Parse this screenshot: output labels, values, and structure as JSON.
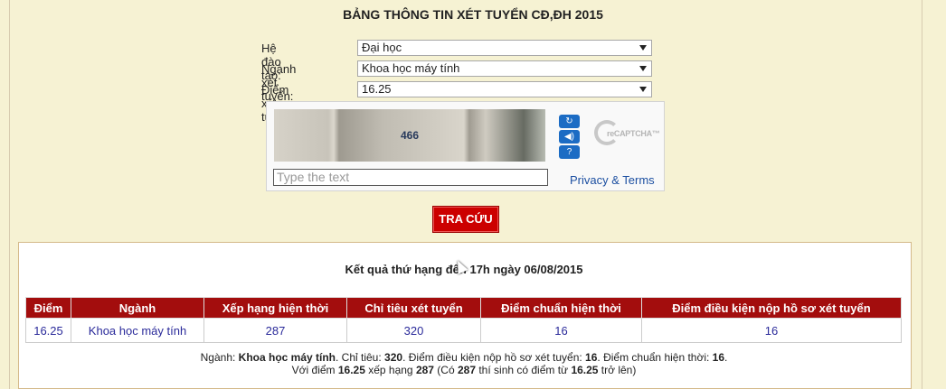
{
  "title": "BẢNG THÔNG TIN XÉT TUYỂN CĐ,ĐH 2015",
  "form": {
    "he_dao_tao_label": "Hệ đào tạo:",
    "he_dao_tao_value": "Đại học",
    "nganh_label": "Ngành xét tuyển:",
    "nganh_value": "Khoa học máy tính",
    "diem_label": "Điểm xét tuyển:",
    "diem_value": "16.25"
  },
  "captcha": {
    "image_text": "466",
    "input_placeholder": "Type the text",
    "logo_text": "reCAPTCHA™",
    "privacy_terms": "Privacy & Terms"
  },
  "search_button": "TRA CỨU",
  "result": {
    "title": "Kết quả thứ hạng đến 17h ngày 06/08/2015",
    "headers": [
      "Điểm",
      "Ngành",
      "Xếp hạng hiện thời",
      "Chỉ tiêu xét tuyển",
      "Điểm chuẩn hiện thời",
      "Điểm điều kiện nộp hồ sơ xét tuyển"
    ],
    "row": [
      "16.25",
      "Khoa học máy tính",
      "287",
      "320",
      "16",
      "16"
    ],
    "summary": {
      "l1_a": "Ngành: ",
      "l1_b": "Khoa học máy tính",
      "l1_c": ". Chỉ tiêu: ",
      "l1_d": "320",
      "l1_e": ". Điểm điều kiện nộp hồ sơ xét tuyển: ",
      "l1_f": "16",
      "l1_g": ". Điểm chuẩn hiện thời: ",
      "l1_h": "16",
      "l1_i": ".",
      "l2_a": "Với điểm ",
      "l2_b": "16.25",
      "l2_c": " xếp hạng ",
      "l2_d": "287",
      "l2_e": " (Có ",
      "l2_f": "287",
      "l2_g": " thí sinh có điểm từ ",
      "l2_h": "16.25",
      "l2_i": " trở lên)"
    }
  }
}
